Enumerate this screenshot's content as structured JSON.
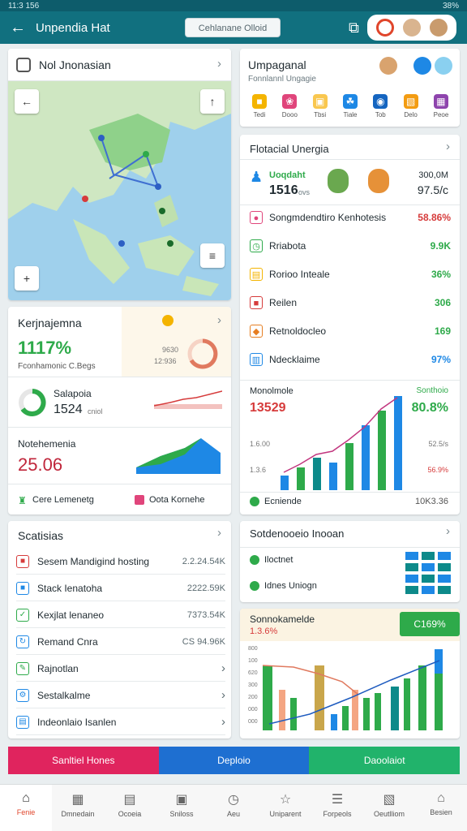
{
  "status": {
    "time": "11:3 156",
    "right": "38%"
  },
  "appbar": {
    "title": "Unpendia Hat",
    "search_placeholder": "Cehlanane Olloid"
  },
  "map_card": {
    "title": "Nol Jnonasian"
  },
  "top_right": {
    "title": "Umpaganal",
    "subtitle": "Fonnlannl Ungagie",
    "icons": [
      {
        "label": "Tedi",
        "color": "#f4b400",
        "icon": "square-icon"
      },
      {
        "label": "Dooo",
        "color": "#e0457b",
        "icon": "flower-icon"
      },
      {
        "label": "Tbsi",
        "color": "#f9c74f",
        "icon": "lock-icon"
      },
      {
        "label": "Tiale",
        "color": "#1e88e5",
        "icon": "leaf-icon"
      },
      {
        "label": "Tob",
        "color": "#1565c0",
        "icon": "car-icon"
      },
      {
        "label": "Delo",
        "color": "#f39c12",
        "icon": "bag-icon"
      },
      {
        "label": "Peoe",
        "color": "#8e44ad",
        "icon": "grid-icon"
      }
    ]
  },
  "notifications": {
    "title": "Flotacial Unergia",
    "highlight_label": "Uoqdaht",
    "highlight_value": "1516",
    "highlight_unit": "ovs",
    "right_top": "300,0M",
    "right_value": "97.5/c",
    "rows": [
      {
        "label": "Songmdendtiro Kenhotesis",
        "value": "58.86%",
        "color": "#e0457b",
        "vcolor": "#d63b3b",
        "icon": "pin-icon"
      },
      {
        "label": "Rriabota",
        "value": "9.9K",
        "color": "#2eaa4a",
        "vcolor": "#2eaa4a",
        "icon": "clock-icon"
      },
      {
        "label": "Rorioo Inteale",
        "value": "36%",
        "color": "#f4b400",
        "vcolor": "#2eaa4a",
        "icon": "folder-icon"
      },
      {
        "label": "Reilen",
        "value": "306",
        "color": "#d63b3b",
        "vcolor": "#2eaa4a",
        "icon": "square-icon"
      },
      {
        "label": "Retnoldocleo",
        "value": "169",
        "color": "#e67e22",
        "vcolor": "#2eaa4a",
        "icon": "tag-icon"
      },
      {
        "label": "Ndecklaime",
        "value": "97%",
        "color": "#1e88e5",
        "vcolor": "#1e88e5",
        "icon": "chart-icon"
      }
    ],
    "chart_title": "Monolmole",
    "chart_value": "13529",
    "chart_right_label": "Sonthoio",
    "chart_right_value": "80.8%",
    "labels_left": [
      "1.6.00",
      "1.3.6"
    ],
    "labels_right": [
      "52.5/s",
      "56.9%"
    ],
    "footer_left": "Ecniende",
    "footer_right": "10K3.36"
  },
  "left_mid": {
    "title": "Kerjnajemna",
    "big_value": "1117%",
    "sub": "Fconhamonic C.Begs",
    "gauge_small": "9630",
    "gauge_small2": "12:936",
    "row2_title": "Salapoia",
    "row2_value": "1524",
    "row2_unit": "cniol",
    "row3_title": "Notehemenia",
    "row3_value": "25.06",
    "footer_left": "Cere Lemenetg",
    "footer_right": "Oota Kornehe"
  },
  "settings": {
    "title": "Scatisias",
    "rows": [
      {
        "label": "Sesem Mandigind hosting",
        "value": "2.2.24.54K",
        "color": "#d63b3b",
        "icon": "square-icon",
        "arrow": false
      },
      {
        "label": "Stack Ienatoha",
        "value": "2222.59K",
        "color": "#1e88e5",
        "icon": "blue-square-icon",
        "arrow": false
      },
      {
        "label": "Kexjlat lenaneo",
        "value": "7373.54K",
        "color": "#2eaa4a",
        "icon": "check-icon",
        "arrow": false
      },
      {
        "label": "Remand Cnra",
        "value": "CS 94.96K",
        "color": "#1e88e5",
        "icon": "refresh-icon",
        "arrow": false
      },
      {
        "label": "Rajnotlan",
        "value": "",
        "color": "#2eaa4a",
        "icon": "edit-icon",
        "arrow": true
      },
      {
        "label": "Sestalkalme",
        "value": "",
        "color": "#1e88e5",
        "icon": "gear-icon",
        "arrow": true
      },
      {
        "label": "Indeonlaio Isanlen",
        "value": "",
        "color": "#1e88e5",
        "icon": "doc-icon",
        "arrow": true
      }
    ]
  },
  "right_info": {
    "title": "Sotdenooeio Inooan",
    "row1": "Iloctnet",
    "row2": "Idnes Uniogn"
  },
  "right_chart": {
    "title": "Sonnokamelde",
    "value": "1.3.6%",
    "badge": "C169%",
    "ylabels": [
      "800",
      "100",
      "620",
      "300",
      "200",
      "000",
      "000"
    ]
  },
  "banner": {
    "left": "Sanltiel Hones",
    "mid": "Deploio",
    "right": "Daoolaiot"
  },
  "bottomnav": [
    {
      "label": "Fenie",
      "icon": "home-icon",
      "active": true
    },
    {
      "label": "Dmnedain",
      "icon": "calendar-icon",
      "active": false
    },
    {
      "label": "Ocoeia",
      "icon": "note-icon",
      "active": false
    },
    {
      "label": "Sniloss",
      "icon": "inbox-icon",
      "active": false
    },
    {
      "label": "Aeu",
      "icon": "clock-icon",
      "active": false
    },
    {
      "label": "Uniparent",
      "icon": "star-icon",
      "active": false
    },
    {
      "label": "Forpeols",
      "icon": "list-icon",
      "active": false
    },
    {
      "label": "Oeutlliom",
      "icon": "bag-icon",
      "active": false
    },
    {
      "label": "Besien",
      "icon": "house-icon",
      "active": false
    }
  ]
}
